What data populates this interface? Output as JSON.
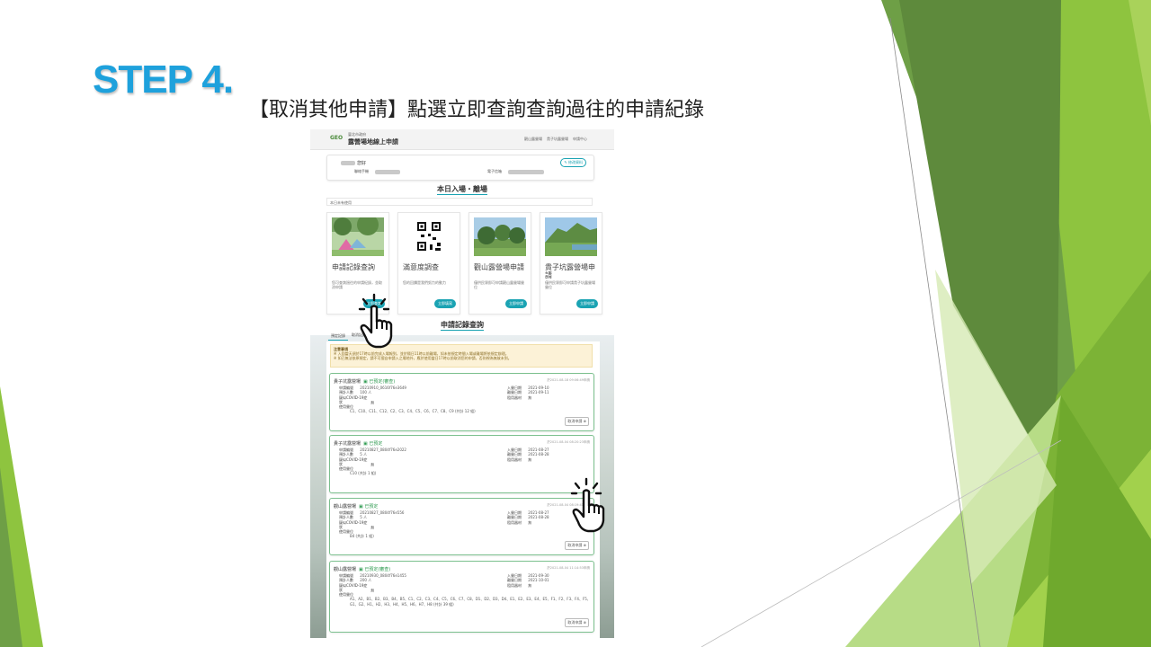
{
  "slide": {
    "step_label": "STEP 4.",
    "instruction": "【取消其他申請】點選立即查詢查詢過往的申請紀錄"
  },
  "header": {
    "logo": "GEO",
    "site_subtitle": "臺北市政府",
    "site_title": "露營場地線上申請",
    "nav": [
      "觀山露營場",
      "貴子坑露營場",
      "申請中心"
    ]
  },
  "profile": {
    "name_suffix": "您好",
    "phone_label": "聯絡手機",
    "email_label": "電子信箱",
    "edit_button": "修改資料"
  },
  "today_section": {
    "title": "本日入場・離場",
    "empty_note": "本日未有使用"
  },
  "cards": [
    {
      "title": "申請記錄查詢",
      "desc": "您可查詢過往的申請紀錄，並取消申請",
      "button": "立即查詢"
    },
    {
      "title": "滿意度調查",
      "desc": "您的回饋是我們努力的動力",
      "button": "立即填寫"
    },
    {
      "title": "觀山露營場申請",
      "desc": "僅供民眾即可申請觀山露營場營位",
      "button": "立即申請"
    },
    {
      "title": "貴子坑露營場申請",
      "desc": "僅供民眾即可申請貴子坑露營場營位",
      "button": "立即申請"
    }
  ],
  "records_section": {
    "title": "申請記錄查詢",
    "tabs": [
      "預定記錄",
      "取消記錄"
    ],
    "notice_title": "注意事項",
    "notice_lines": [
      "※ 入園當天須於17時以前完成入場報到，並於隔日11時以前離場，如未依規定時間入場或離場將依規定辦理。",
      "※ 如已無法依原規定，請不可擅自申請入之場地外，應於使用當日17時以前取消您的申請，否則視為無故未到。"
    ]
  },
  "labels": {
    "app_no": "申請編號",
    "people": "預計人數",
    "covid": "疑似COVID-19症狀",
    "seats": "使用營位",
    "checkin": "入營日期",
    "checkout": "離營日期",
    "rental": "租用器材",
    "cancel": "取消申請"
  },
  "records": [
    {
      "site": "貴子坑露營場",
      "status": "已預定(審查)",
      "timestamp": "於2021-08-18 09:06:49申請",
      "app_no": "20210910_0616f76e3649",
      "people": "100 人",
      "covid": "無",
      "seats": "C1、C10、C11、C12、C2、C3、C4、C5、C6、C7、C8、C9 (共計 12 組)",
      "checkin": "2021-09-10",
      "checkout": "2021-09-11",
      "rental": "無"
    },
    {
      "site": "貴子坑露營場",
      "status": "已預定",
      "timestamp": "於2021-08-04 08:20:23申請",
      "app_no": "20210827_0804f76e2022",
      "people": "5 人",
      "covid": "無",
      "seats": "C10 (共計 1 組)",
      "checkin": "2021-08-27",
      "checkout": "2021-08-28",
      "rental": "無"
    },
    {
      "site": "觀山露營場",
      "status": "已預定",
      "timestamp": "於2021-08-04 08:19:41申請",
      "app_no": "20210827_0804f76e556",
      "people": "5 人",
      "covid": "無",
      "seats": "B4 (共計 1 組)",
      "checkin": "2021-08-27",
      "checkout": "2021-08-28",
      "rental": "無"
    },
    {
      "site": "觀山露營場",
      "status": "已預定(審查)",
      "timestamp": "於2021-08-04 11:14:53申請",
      "app_no": "20210930_0804f76e1455",
      "people": "200 人",
      "covid": "無",
      "seats": "A1、A2、B1、B2、B3、B4、B5、C1、C2、C3、C4、C5、C6、C7、C8、D1、D2、D3、D4、E1、E2、E3、E4、E5、F1、F2、F3、F4、F5、G1、G2、H1、H2、H3、H4、H5、H6、H7、H8 (共計 39 組)",
      "checkin": "2021-09-30",
      "checkout": "2021-10-01",
      "rental": "無"
    }
  ]
}
